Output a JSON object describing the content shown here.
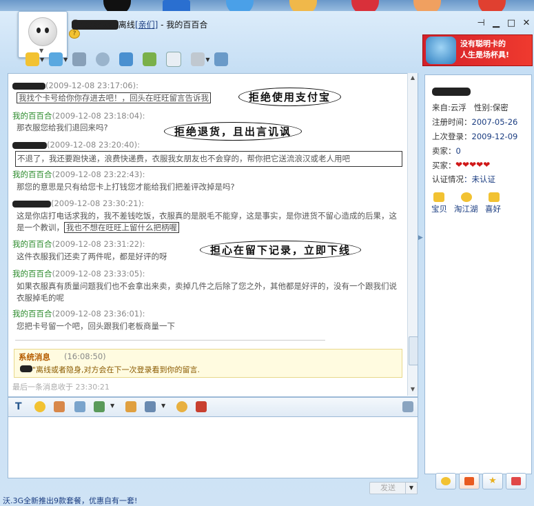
{
  "window": {
    "status_label": "离线",
    "group_label": "[亲们]",
    "title_sep": "-",
    "app_title": "我的百百合",
    "controls": [
      "pin-icon",
      "minimize-icon",
      "maximize-icon",
      "close-icon"
    ]
  },
  "toolbar": {
    "icons": [
      "chat-bubble-icon",
      "transfer-icon",
      "microphone-icon",
      "webcam-icon",
      "add-contact-icon",
      "game-icon",
      "email-icon",
      "share-icon",
      "history-icon"
    ]
  },
  "ad": {
    "line1": "没有聪明卡的",
    "line2": "人生是场杯具!"
  },
  "messages": [
    {
      "sender_type": "other",
      "sender": "",
      "time": "(2009-12-08 23:17:06):",
      "text": "我找个卡号给你你存进去吧！，回头在旺旺留言告诉我"
    },
    {
      "sender_type": "me",
      "sender": "我的百百合",
      "time": "(2009-12-08 23:18:04):",
      "text": "那衣服您给我们退回来吗?"
    },
    {
      "sender_type": "other",
      "sender": "",
      "time": "(2009-12-08 23:20:40):",
      "text": "不退了，我还要跑快递，浪费快递费，衣服我女朋友也不会穿的，帮你把它送流浪汉或老人用吧"
    },
    {
      "sender_type": "me",
      "sender": "我的百百合",
      "time": "(2009-12-08 23:22:43):",
      "text": "那您的意思是只有给您卡上打钱您才能给我们把差评改掉是吗?"
    },
    {
      "sender_type": "other",
      "sender": "",
      "time": "(2009-12-08 23:30:21):",
      "text_part1": "这是你店打电话求我的，我不差钱吃饭，衣服真的是脱毛不能穿，这是事实，是你进货不留心造成的后果，这是一个教训，",
      "text_part2": "我也不想在旺旺上留什么把柄喔"
    },
    {
      "sender_type": "me",
      "sender": "我的百百合",
      "time": "(2009-12-08 23:31:22):",
      "text": "这件衣服我们还卖了两件呢，都是好评的呀"
    },
    {
      "sender_type": "me",
      "sender": "我的百百合",
      "time": "(2009-12-08 23:33:05):",
      "text": "如果衣服真有质量问题我们也不会拿出来卖，卖掉几件之后除了您之外，其他都是好评的，没有一个跟我们说衣服掉毛的呢"
    },
    {
      "sender_type": "me",
      "sender": "我的百百合",
      "time": "(2009-12-08 23:36:01):",
      "text": "您把卡号留一个吧，回头跟我们老板商量一下"
    }
  ],
  "annotations": {
    "a1": "拒绝使用支付宝",
    "a2": "拒绝退货，且出言讥讽",
    "a3": "担心在留下记录，立即下线"
  },
  "system": {
    "title": "系统消息",
    "time": "(16:08:50)",
    "text": "\"离线或者隐身,对方会在下一次登录看到你的留言."
  },
  "last_message": "最后一条消息收于 23:30:21",
  "input_toolbar": {
    "icons": [
      "font-icon",
      "emoticon-icon",
      "screenshot-icon",
      "quick-reply-icon",
      "image-icon",
      "send-image-icon",
      "template-icon",
      "shake-icon",
      "paint-icon",
      "settings-icon"
    ]
  },
  "send": {
    "label": "发送"
  },
  "bottom_text": "沃.3G全新推出9款套餐，优惠自有一套!",
  "profile": {
    "from_label": "来自:云浮",
    "gender_label": "性别:保密",
    "reg_label": "注册时间：",
    "reg_value": "2007-05-26",
    "last_login_label": "上次登录：",
    "last_login_value": "2009-12-09",
    "seller_label": "卖家：",
    "seller_value": "0",
    "buyer_label": "买家：",
    "buyer_hearts": "❤❤❤❤❤",
    "cert_label": "认证情况",
    "cert_value": "：未认证",
    "links": [
      "宝贝",
      "淘江湖",
      "喜好"
    ]
  },
  "right_tabs": [
    "chat-tab-icon",
    "taobao-tab-icon",
    "star-tab-icon",
    "shirt-tab-icon"
  ],
  "colors": {
    "me": "#2a8a2a",
    "other": "#1a3c80",
    "system": "#b55b00"
  }
}
